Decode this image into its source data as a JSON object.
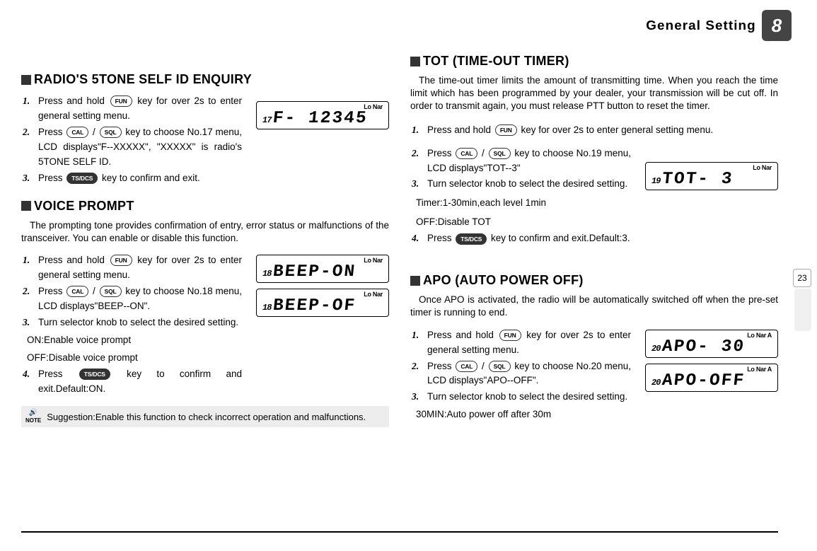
{
  "header": {
    "title": "General Setting",
    "chapter": "8",
    "page_side": "23"
  },
  "keys": {
    "FUN": "FUN",
    "CAL": "CAL",
    "SQL": "SQL",
    "TSDCS": "TS/DCS"
  },
  "left": {
    "s1": {
      "title": "RADIO'S 5TONE SELF ID  ENQUIRY",
      "steps": [
        "Press and hold {FUN} key for over 2s to enter general setting menu.",
        "Press {CAL} / {SQL} key to choose No.17 menu, LCD displays\"F--XXXXX\", \"XXXXX\" is radio's 5TONE SELF ID.",
        "Press {TSDCS} key to confirm and exit."
      ],
      "lcd": {
        "top": "Lo Nar",
        "ch": "17",
        "seg": "F- 12345"
      }
    },
    "s2": {
      "title": "VOICE PROMPT",
      "intro": "The prompting tone provides confirmation of entry, error status or malfunctions of the transceiver. You can enable or disable this function.",
      "steps": [
        "Press and hold {FUN} key for over 2s to enter general setting menu.",
        "Press {CAL} / {SQL} key to choose No.18 menu, LCD displays\"BEEP--ON\".",
        "Turn selector knob to select the desired setting.",
        "Press {TSDCS}  key to confirm and exit.Default:ON."
      ],
      "sub1": "ON:Enable voice prompt",
      "sub2": "OFF:Disable voice prompt",
      "lcd1": {
        "top": "Lo Nar",
        "ch": "18",
        "seg": "BEEP-ON"
      },
      "lcd2": {
        "top": "Lo Nar",
        "ch": "18",
        "seg": "BEEP-OF"
      },
      "note": "Suggestion:Enable this function to check incorrect operation and malfunctions.",
      "note_label": "NOTE"
    }
  },
  "right": {
    "s3": {
      "title": "TOT (TIME-OUT TIMER)",
      "intro": "The time-out timer limits the amount of transmitting time. When you reach the time limit which has been programmed by your dealer, your transmission will be cut off. In order to transmit again, you must release PTT button to reset the timer.",
      "steps_a": "Press and hold {FUN} key for over 2s to enter general setting menu.",
      "steps_b": "Press {CAL} / {SQL}  key to choose No.19 menu, LCD displays\"TOT--3\"",
      "steps_c": "Turn selector knob to select the desired setting.",
      "steps_d": "Press {TSDCS}  key to confirm and exit.Default:3.",
      "sub1": "Timer:1-30min,each level 1min",
      "sub2": "OFF:Disable TOT",
      "lcd": {
        "top": "Lo Nar",
        "ch": "19",
        "seg": "TOT-  3"
      }
    },
    "s4": {
      "title": "APO (AUTO POWER OFF)",
      "intro": "Once APO is activated, the radio will be automatically switched off when the pre-set timer is running to end.",
      "steps": [
        "Press and hold {FUN} key for over 2s to enter general setting menu.",
        "Press {CAL} / {SQL} key to choose No.20 menu, LCD displays\"APO--OFF\".",
        "Turn selector knob to select the desired setting."
      ],
      "sub1": "30MIN:Auto power off after 30m",
      "lcd1": {
        "top": "Lo Nar A",
        "ch": "20",
        "seg": "APO-  30"
      },
      "lcd2": {
        "top": "Lo Nar A",
        "ch": "20",
        "seg": "APO-OFF"
      }
    }
  }
}
